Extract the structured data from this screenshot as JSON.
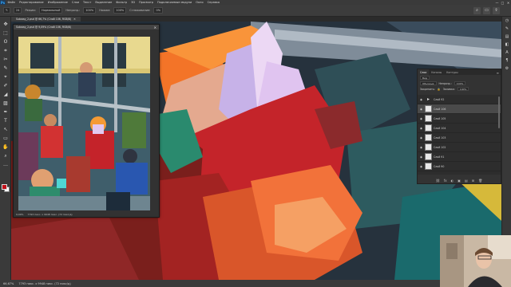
{
  "app": {
    "logo": "Ps"
  },
  "menubar": {
    "items": [
      "Файл",
      "Редактирование",
      "Изображение",
      "Слои",
      "Текст",
      "Выделение",
      "Фильтр",
      "3D",
      "Просмотр",
      "Подключаемые модули",
      "Окно",
      "Справка"
    ],
    "window_controls": [
      "—",
      "□",
      "✕"
    ]
  },
  "options": {
    "brush_size": "24",
    "mode_label": "Режим:",
    "mode_value": "Нормальный",
    "opacity_label": "Непрозр.:",
    "opacity_value": "100%",
    "flow_label": "Нажим:",
    "flow_value": "100%",
    "smoothing_label": "Сглаживание:",
    "smoothing_value": "0%",
    "right_icons": [
      "⌕",
      "▭",
      "⇪"
    ]
  },
  "document": {
    "tab_title": "Subway_2.psd @ 66,7% (Слой 106, RGB/8)",
    "tab_close": "✕"
  },
  "tools": [
    "✥",
    "⬚",
    "ʘ",
    "⌗",
    "✂",
    "✎",
    "⌖",
    "✐",
    "◢",
    "▨",
    "✒",
    "T",
    "↖",
    "▭",
    "✋",
    "⌕",
    "…"
  ],
  "colors": {
    "foreground": "#c1101a",
    "background": "#ffffff",
    "accent": "#31a8ff"
  },
  "right_strip_icons": [
    "◷",
    "✎",
    "▤",
    "◧",
    "A",
    "¶",
    "⚙"
  ],
  "navigator": {
    "title": "Subway_2.psd @ 9,09% (Слой 106, RGB/8)",
    "close": "✕",
    "zoom": "9,09%",
    "info": "7793 пикс. х 9948 пикс. (72 пикс/д)"
  },
  "layers_panel": {
    "tabs": [
      "Слои",
      "Каналы",
      "Контуры"
    ],
    "active_tab": "Слои",
    "menu_icon": "≡",
    "filter_label": "Вид",
    "blend_mode": "Обычные",
    "opacity_label": "Непрозр.:",
    "opacity_value": "100%",
    "lock_label": "Закрепить:",
    "fill_label": "Заливка:",
    "fill_value": "100%",
    "layers": [
      {
        "name": "Слой 92",
        "type": "folder",
        "selected": false
      },
      {
        "name": "Слой 106",
        "type": "layer",
        "selected": true
      },
      {
        "name": "Слой 105",
        "type": "layer",
        "selected": false
      },
      {
        "name": "Слой 104",
        "type": "layer",
        "selected": false
      },
      {
        "name": "Слой 103",
        "type": "layer",
        "selected": false
      },
      {
        "name": "Слой 102",
        "type": "layer",
        "selected": false
      },
      {
        "name": "Слой 91",
        "type": "layer",
        "selected": false
      },
      {
        "name": "Слой 90",
        "type": "layer",
        "selected": false
      }
    ],
    "footer_icons": [
      "⛓",
      "fx",
      "◐",
      "▣",
      "▤",
      "⊞",
      "🗑"
    ]
  },
  "status": {
    "zoom": "66,67%",
    "doc_info": "7793 пикс. х 9948 пикс. (72 пикс/д)"
  }
}
